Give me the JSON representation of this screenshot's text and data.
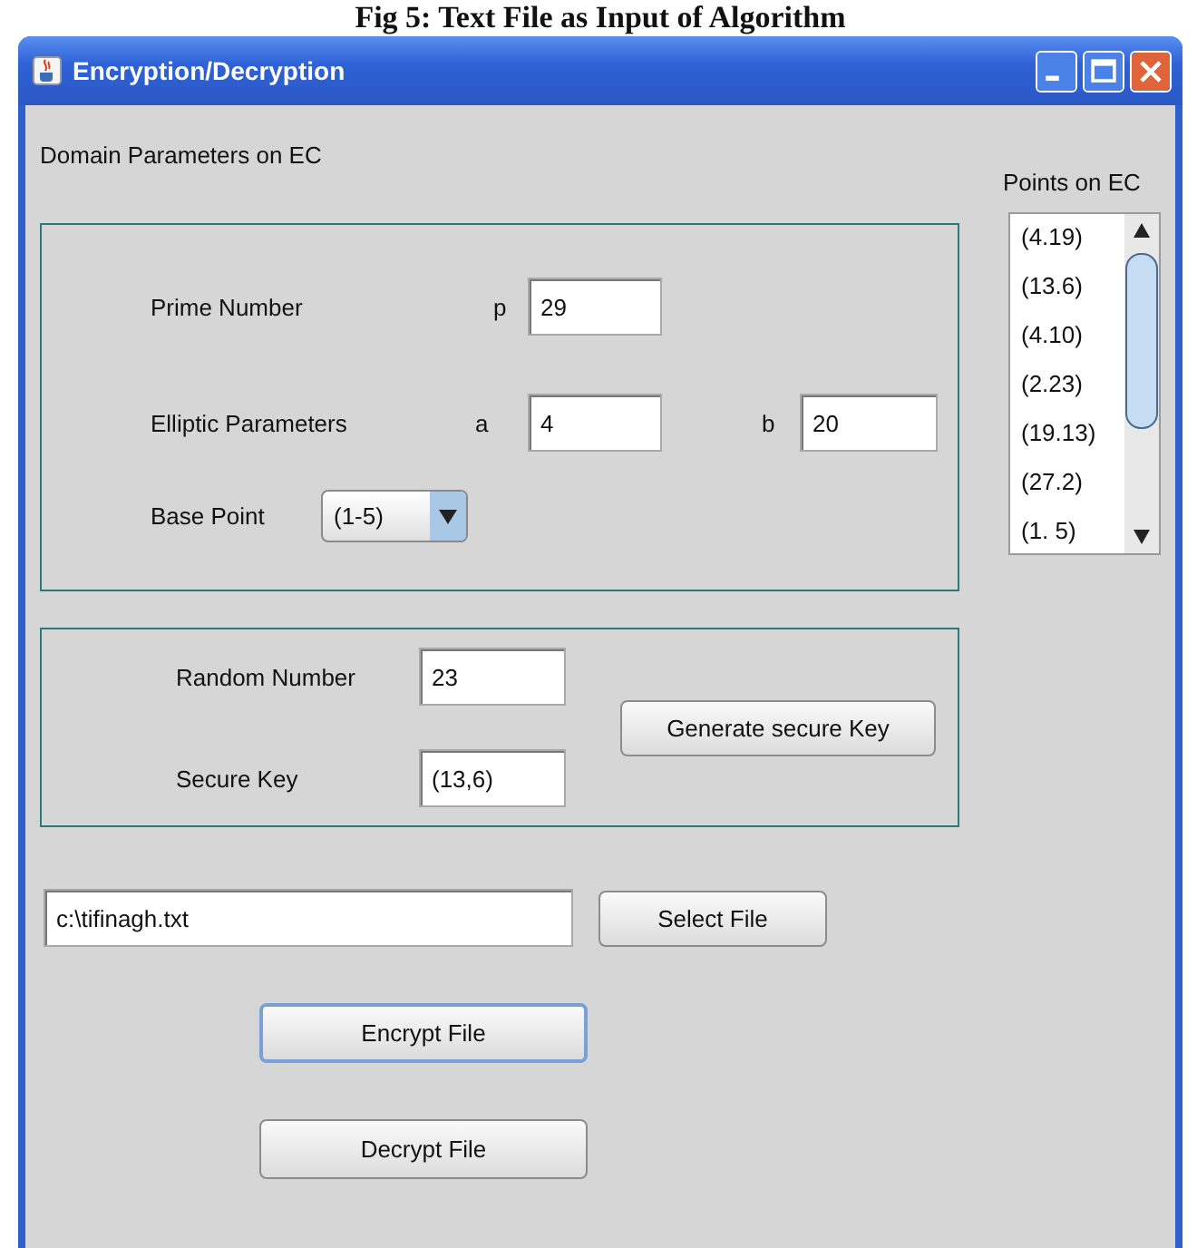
{
  "caption": "Fig 5: Text File as Input of Algorithm",
  "window": {
    "title": "Encryption/Decryption"
  },
  "domain_heading": "Domain Parameters on EC",
  "domain_panel": {
    "prime": {
      "label": "Prime Number",
      "var_label": "p",
      "value": "29"
    },
    "elliptic": {
      "label": "Elliptic Parameters",
      "a_label": "a",
      "a_value": "4",
      "b_label": "b",
      "b_value": "20"
    },
    "base_point": {
      "label": "Base Point",
      "value": "(1-5)"
    }
  },
  "points": {
    "heading": "Points on EC",
    "items": [
      "(4.19)",
      "(13.6)",
      "(4.10)",
      "(2.23)",
      "(19.13)",
      "(27.2)",
      "(1. 5)"
    ]
  },
  "key_panel": {
    "random": {
      "label": "Random Number",
      "value": "23"
    },
    "secure": {
      "label": "Secure Key",
      "value": "(13,6)"
    },
    "button": "Generate secure Key"
  },
  "file": {
    "value": "c:\\tifinagh.txt",
    "button": "Select File"
  },
  "actions": [
    {
      "label": "Encrypt File",
      "focused": true
    },
    {
      "label": "Decrypt File",
      "focused": false
    }
  ]
}
